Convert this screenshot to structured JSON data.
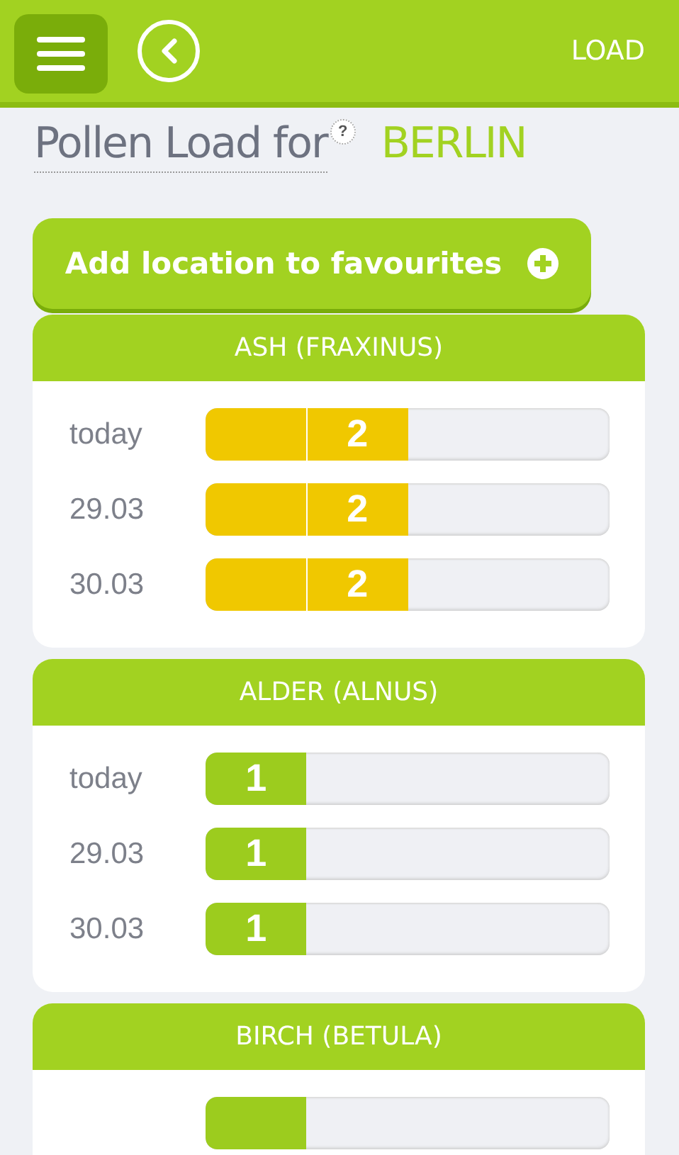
{
  "header": {
    "action": "LOAD"
  },
  "title": {
    "label": "Pollen Load for",
    "help": "?",
    "city": "BERLIN"
  },
  "favourite_button": {
    "label": "Add location to favourites"
  },
  "cards": [
    {
      "title": "ASH (FRAXINUS)",
      "rows": [
        {
          "date": "today",
          "value": "2",
          "level": 0.5,
          "color": "#f0c800"
        },
        {
          "date": "29.03",
          "value": "2",
          "level": 0.5,
          "color": "#f0c800"
        },
        {
          "date": "30.03",
          "value": "2",
          "level": 0.5,
          "color": "#f0c800"
        }
      ]
    },
    {
      "title": "ALDER (ALNUS)",
      "rows": [
        {
          "date": "today",
          "value": "1",
          "level": 0.25,
          "color": "#9ccc1e"
        },
        {
          "date": "29.03",
          "value": "1",
          "level": 0.25,
          "color": "#9ccc1e"
        },
        {
          "date": "30.03",
          "value": "1",
          "level": 0.25,
          "color": "#9ccc1e"
        }
      ]
    },
    {
      "title": "BIRCH (BETULA)",
      "rows": [
        {
          "level": 0.25,
          "color": "#9ccc1e"
        }
      ]
    }
  ]
}
